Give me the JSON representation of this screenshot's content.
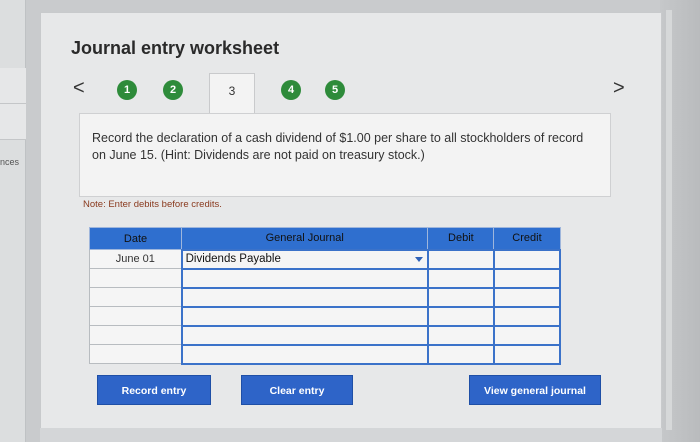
{
  "background": {
    "left_label": "nces"
  },
  "worksheet": {
    "title": "Journal entry worksheet",
    "nav_prev": "<",
    "nav_next": ">",
    "steps": [
      "1",
      "2",
      "3",
      "4",
      "5"
    ],
    "active_step": "3"
  },
  "instruction": "Record the declaration of a cash dividend of $1.00 per share to all stockholders of record on June 15. (Hint: Dividends are not paid on treasury stock.)",
  "note": "Note: Enter debits before credits.",
  "journal": {
    "headers": {
      "date": "Date",
      "account": "General Journal",
      "debit": "Debit",
      "credit": "Credit"
    },
    "rows": [
      {
        "date": "June 01",
        "account": "Dividends Payable",
        "debit": "",
        "credit": ""
      },
      {
        "date": "",
        "account": "",
        "debit": "",
        "credit": ""
      },
      {
        "date": "",
        "account": "",
        "debit": "",
        "credit": ""
      },
      {
        "date": "",
        "account": "",
        "debit": "",
        "credit": ""
      },
      {
        "date": "",
        "account": "",
        "debit": "",
        "credit": ""
      },
      {
        "date": "",
        "account": "",
        "debit": "",
        "credit": ""
      }
    ]
  },
  "buttons": {
    "record": "Record entry",
    "clear": "Clear entry",
    "view": "View general journal"
  },
  "colors": {
    "step_green": "#2e8b3a",
    "header_blue": "#2f6fcf",
    "button_blue": "#2e64c8",
    "note_text": "#8a3a1e"
  }
}
